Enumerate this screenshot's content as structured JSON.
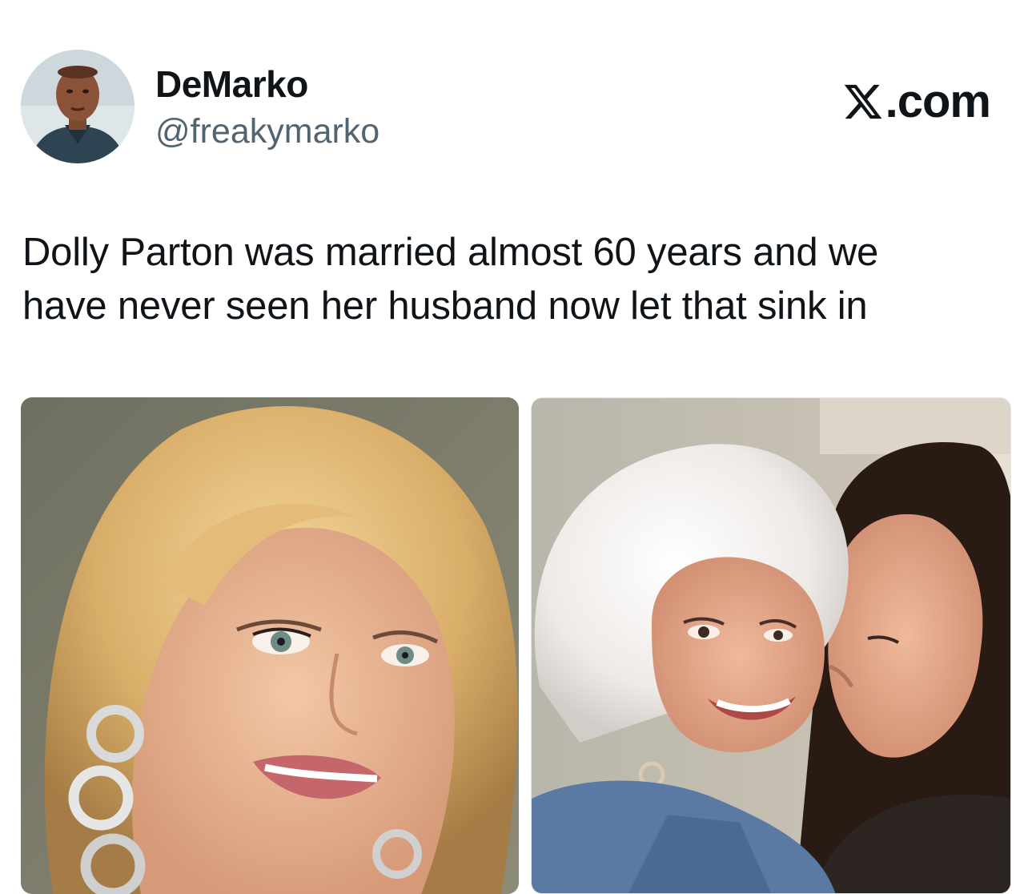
{
  "author": {
    "display_name": "DeMarko",
    "handle": "@freakymarko",
    "avatar": "profile-photo"
  },
  "brand": {
    "icon": "x-logo-icon",
    "label": ".com"
  },
  "tweet": {
    "lines": [
      "Dolly Parton was married almost 60 years and we",
      "have never seen her husband now let that sink in"
    ]
  },
  "media": {
    "photos": [
      {
        "subject": "portrait-blonde-woman"
      },
      {
        "subject": "couple-kiss-on-cheek"
      }
    ]
  },
  "colors": {
    "text_primary": "#0f1419",
    "text_secondary": "#536471",
    "background": "#ffffff"
  }
}
